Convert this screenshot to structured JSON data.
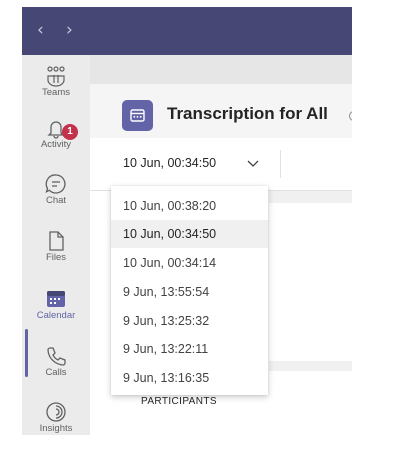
{
  "colors": {
    "titlebar": "#464775",
    "accent": "#6264a7",
    "badge": "#c4314b"
  },
  "nav": {
    "back_icon": "chevron-left-icon",
    "forward_icon": "chevron-right-icon",
    "back": "‹",
    "forward": "›"
  },
  "rail": {
    "items": [
      {
        "label": "Teams",
        "icon": "teams-icon"
      },
      {
        "label": "Activity",
        "icon": "bell-icon",
        "badge": "1"
      },
      {
        "label": "Chat",
        "icon": "chat-icon"
      },
      {
        "label": "Files",
        "icon": "file-icon"
      },
      {
        "label": "Calendar",
        "icon": "calendar-icon",
        "active": true
      },
      {
        "label": "Calls",
        "icon": "phone-icon"
      },
      {
        "label": "Insights",
        "icon": "insights-icon"
      }
    ]
  },
  "header": {
    "title": "Transcription for All",
    "icon": "calendar-icon"
  },
  "selector": {
    "value": "10 Jun, 00:34:50",
    "icon": "chevron-down-icon"
  },
  "dropdown": {
    "options": [
      "10 Jun, 00:38:20",
      "10 Jun, 00:34:50",
      "10 Jun, 00:34:14",
      "9 Jun, 13:55:54",
      "9 Jun, 13:25:32",
      "9 Jun, 13:22:11",
      "9 Jun, 13:16:35"
    ],
    "selected": "10 Jun, 00:34:50"
  },
  "section": {
    "participants_label": "PARTICIPANTS"
  }
}
